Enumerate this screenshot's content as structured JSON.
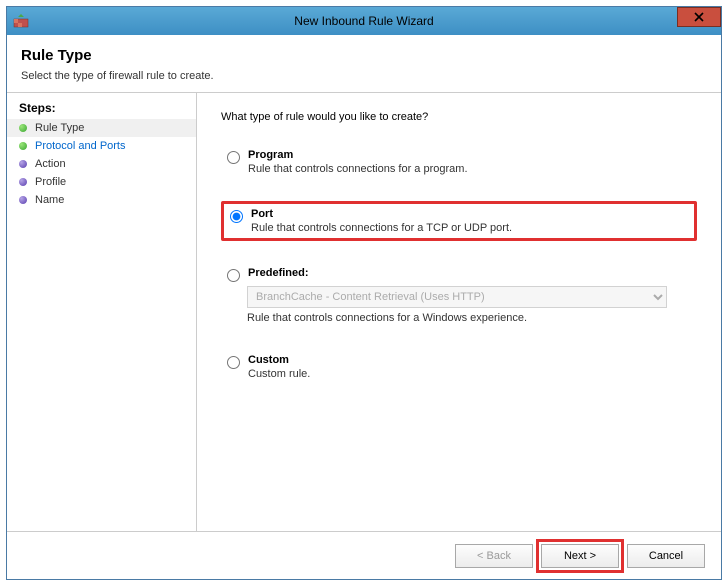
{
  "window": {
    "title": "New Inbound Rule Wizard"
  },
  "header": {
    "title": "Rule Type",
    "subtitle": "Select the type of firewall rule to create."
  },
  "sidebar": {
    "steps_label": "Steps:",
    "items": [
      {
        "label": "Rule Type",
        "selected": true,
        "bullet": "green",
        "link": false
      },
      {
        "label": "Protocol and Ports",
        "selected": false,
        "bullet": "green",
        "link": true
      },
      {
        "label": "Action",
        "selected": false,
        "bullet": "purple",
        "link": false
      },
      {
        "label": "Profile",
        "selected": false,
        "bullet": "purple",
        "link": false
      },
      {
        "label": "Name",
        "selected": false,
        "bullet": "purple",
        "link": false
      }
    ]
  },
  "main": {
    "prompt": "What type of rule would you like to create?",
    "options": {
      "program": {
        "title": "Program",
        "desc": "Rule that controls connections for a program."
      },
      "port": {
        "title": "Port",
        "desc": "Rule that controls connections for a TCP or UDP port."
      },
      "predefined": {
        "title": "Predefined:",
        "desc": "Rule that controls connections for a Windows experience.",
        "select_value": "BranchCache - Content Retrieval (Uses HTTP)"
      },
      "custom": {
        "title": "Custom",
        "desc": "Custom rule."
      }
    }
  },
  "footer": {
    "back": "< Back",
    "next": "Next >",
    "cancel": "Cancel"
  }
}
